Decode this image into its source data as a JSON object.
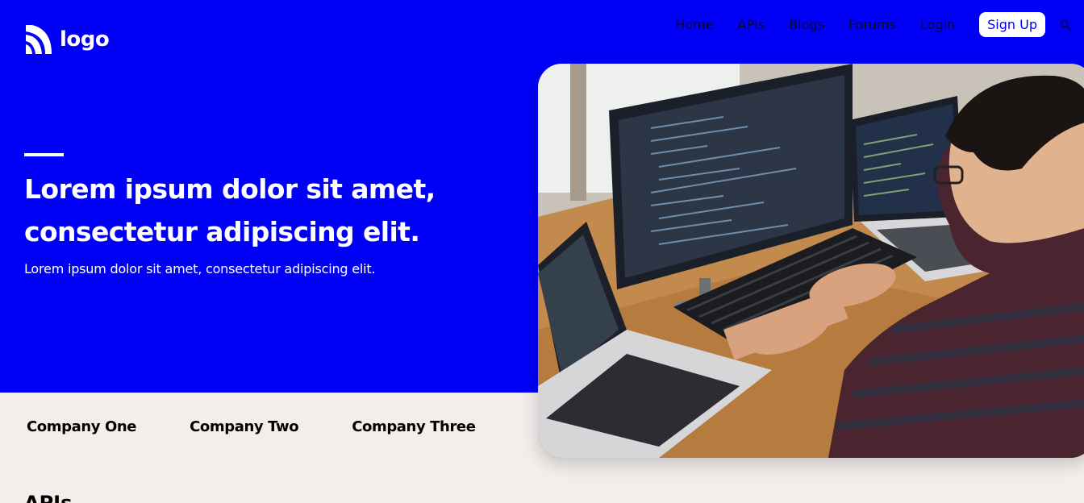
{
  "brand": {
    "logo_text": "logo"
  },
  "nav": {
    "items": [
      {
        "label": "Home"
      },
      {
        "label": "APIs"
      },
      {
        "label": "Blogs"
      },
      {
        "label": "Forums"
      },
      {
        "label": "Login"
      }
    ],
    "signup_label": "Sign Up",
    "search_icon": "search-icon"
  },
  "hero": {
    "headline_line1": "Lorem ipsum dolor sit amet,",
    "headline_line2": "consectetur adipiscing elit.",
    "subheadline": "Lorem ipsum dolor sit amet, consectetur adipiscing elit.",
    "image_subject": "developer coding at desk with monitors and laptops"
  },
  "companies": [
    {
      "name": "Company One"
    },
    {
      "name": "Company Two"
    },
    {
      "name": "Company Three"
    }
  ],
  "section": {
    "title": "APIs"
  },
  "colors": {
    "primary": "#0000f7",
    "background": "#f2eeec",
    "text_dark": "#0a0a1e",
    "white": "#ffffff"
  }
}
